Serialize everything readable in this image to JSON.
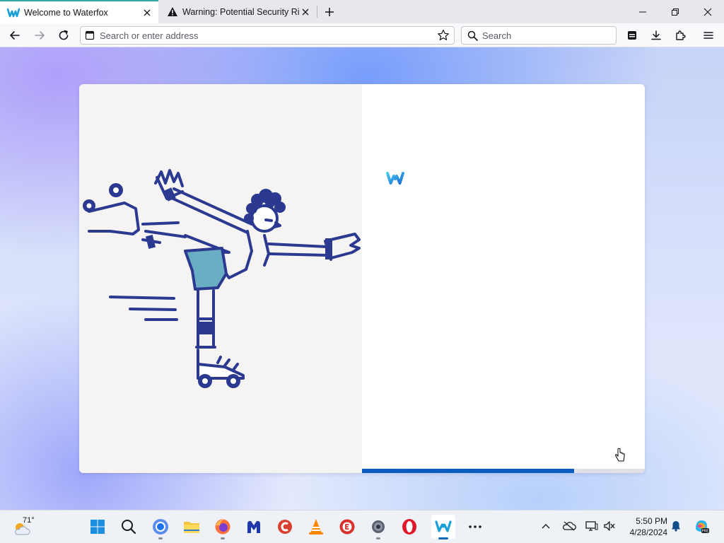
{
  "browser": {
    "tabs": [
      {
        "title": "Welcome to Waterfox",
        "active": true,
        "icon": "waterfox-icon"
      },
      {
        "title": "Warning: Potential Security Risk Ahead",
        "active": false,
        "icon": "warning-icon"
      }
    ],
    "address_placeholder": "Search or enter address",
    "search_placeholder": "Search"
  },
  "welcome": {
    "progress_fraction": 0.75,
    "illustration": "roller-skater-illustration",
    "logo": "waterfox-logo"
  },
  "taskbar": {
    "weather_temp": "71°",
    "clock_time": "5:50 PM",
    "clock_date": "4/28/2024",
    "apps": [
      "start-icon",
      "search-icon",
      "chrome-icon",
      "file-explorer-icon",
      "firefox-icon",
      "malwarebytes-icon",
      "ccleaner-icon",
      "vlc-icon",
      "app-red-icon",
      "settings-icon",
      "opera-icon",
      "waterfox-icon",
      "more-icon"
    ]
  },
  "colors": {
    "accent": "#2ea8a8",
    "progress": "#0b5cc1",
    "illustration_ink": "#2b3990",
    "illustration_fill": "#6aaec4"
  }
}
